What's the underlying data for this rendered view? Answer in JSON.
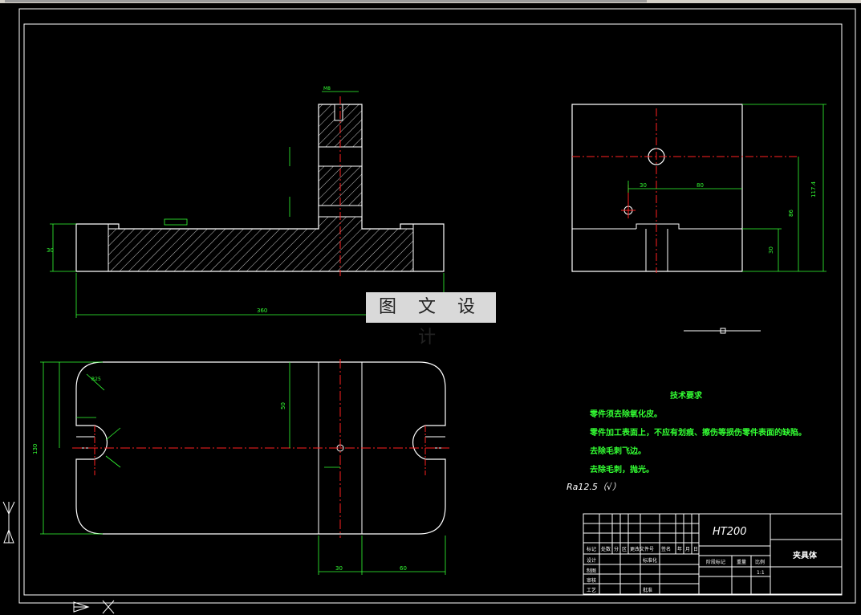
{
  "watermark": "图 文 设 计",
  "tech_req": {
    "title": "技术要求",
    "lines": [
      "零件须去除氧化皮。",
      "零件加工表面上，不应有划痕、擦伤等损伤零件表面的缺陷。",
      "去除毛刺飞边。",
      "去除毛刺，抛光。"
    ]
  },
  "roughness_note": "Ra12.5（√）",
  "dimensions": {
    "front_width": "360",
    "front_height": "30",
    "top_slot": "M8",
    "side_total": "117.4",
    "side_h1": "86",
    "side_h2": "30",
    "side_w1": "30",
    "side_w2": "80",
    "plan_width": "130",
    "plan_half": "50",
    "plan_r": "R25",
    "plan_bottom_a": "30",
    "plan_bottom_b": "60"
  },
  "title_block": {
    "material": "HT200",
    "part_name": "夹具体",
    "rows": [
      "标记",
      "处数",
      "分",
      "区",
      "更改文件号",
      "签名",
      "年",
      "月",
      "日"
    ],
    "left_labels": [
      "设计",
      "制图",
      "审核",
      "工艺"
    ],
    "mid_labels": [
      "标准化",
      "批准"
    ],
    "stage_label": "阶段标记",
    "weight_label": "重量",
    "scale_label": "比例",
    "scale_value": "1:1"
  },
  "colors": {
    "line": "#ffffff",
    "center": "#ff2020",
    "dim": "#33ff33",
    "hatch": "#ffffff"
  }
}
